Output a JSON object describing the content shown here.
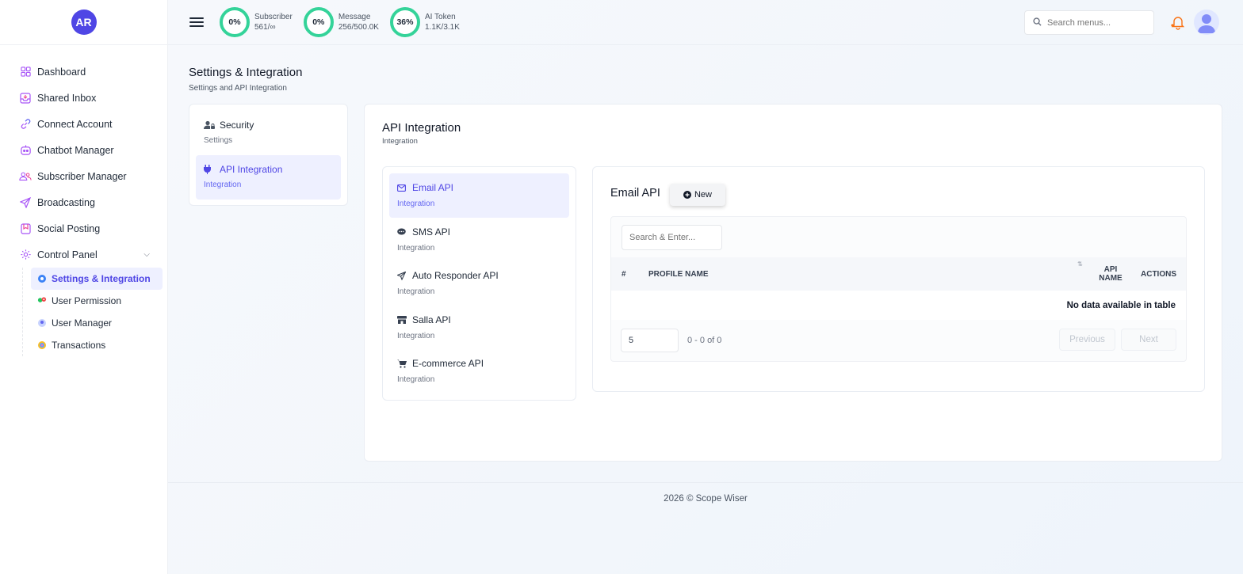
{
  "brand": {
    "initials": "AR",
    "color": "#4f46e5"
  },
  "sidebar": {
    "items": [
      {
        "label": "Dashboard",
        "icon": "grid-icon"
      },
      {
        "label": "Shared Inbox",
        "icon": "inbox-icon"
      },
      {
        "label": "Connect Account",
        "icon": "link-icon"
      },
      {
        "label": "Chatbot Manager",
        "icon": "bot-icon"
      },
      {
        "label": "Subscriber Manager",
        "icon": "users-icon"
      },
      {
        "label": "Broadcasting",
        "icon": "send-icon"
      },
      {
        "label": "Social Posting",
        "icon": "bookmark-icon"
      },
      {
        "label": "Control Panel",
        "icon": "gear-icon"
      }
    ],
    "sub_items": [
      {
        "label": "Settings & Integration",
        "icon": "cog-icon",
        "active": true
      },
      {
        "label": "User Permission",
        "icon": "permission-icon"
      },
      {
        "label": "User Manager",
        "icon": "user-manager-icon"
      },
      {
        "label": "Transactions",
        "icon": "transactions-icon"
      }
    ]
  },
  "topbar": {
    "stats": [
      {
        "percent": "0%",
        "label": "Subscriber",
        "value": "561/∞"
      },
      {
        "percent": "0%",
        "label": "Message",
        "value": "256/500.0K"
      },
      {
        "percent": "36%",
        "label": "AI Token",
        "value": "1.1K/3.1K"
      }
    ],
    "search_placeholder": "Search menus...",
    "accent_ring": "#34d399"
  },
  "page": {
    "title": "Settings & Integration",
    "subtitle": "Settings and API Integration"
  },
  "settings_menu": [
    {
      "title": "Security",
      "sub": "Settings",
      "icon": "user-lock-icon"
    },
    {
      "title": "API Integration",
      "sub": "Integration",
      "icon": "plug-icon",
      "active": true
    }
  ],
  "integration": {
    "title": "API Integration",
    "subtitle": "Integration",
    "apis": [
      {
        "title": "Email API",
        "sub": "Integration",
        "icon": "envelope-icon",
        "active": true
      },
      {
        "title": "SMS API",
        "sub": "Integration",
        "icon": "chat-icon"
      },
      {
        "title": "Auto Responder API",
        "sub": "Integration",
        "icon": "paper-plane-icon"
      },
      {
        "title": "Salla API",
        "sub": "Integration",
        "icon": "store-icon"
      },
      {
        "title": "E-commerce API",
        "sub": "Integration",
        "icon": "cart-icon"
      }
    ]
  },
  "email_panel": {
    "title": "Email API",
    "new_label": "New",
    "search_placeholder": "Search & Enter...",
    "columns": {
      "hash": "#",
      "profile": "PROFILE NAME",
      "sort": "⇅",
      "api": "API NAME",
      "actions": "ACTIONS"
    },
    "empty_message": "No data available in table",
    "page_size": "5",
    "page_info": "0 - 0 of 0",
    "prev_label": "Previous",
    "next_label": "Next"
  },
  "footer": {
    "text": "2026 © Scope Wiser"
  }
}
